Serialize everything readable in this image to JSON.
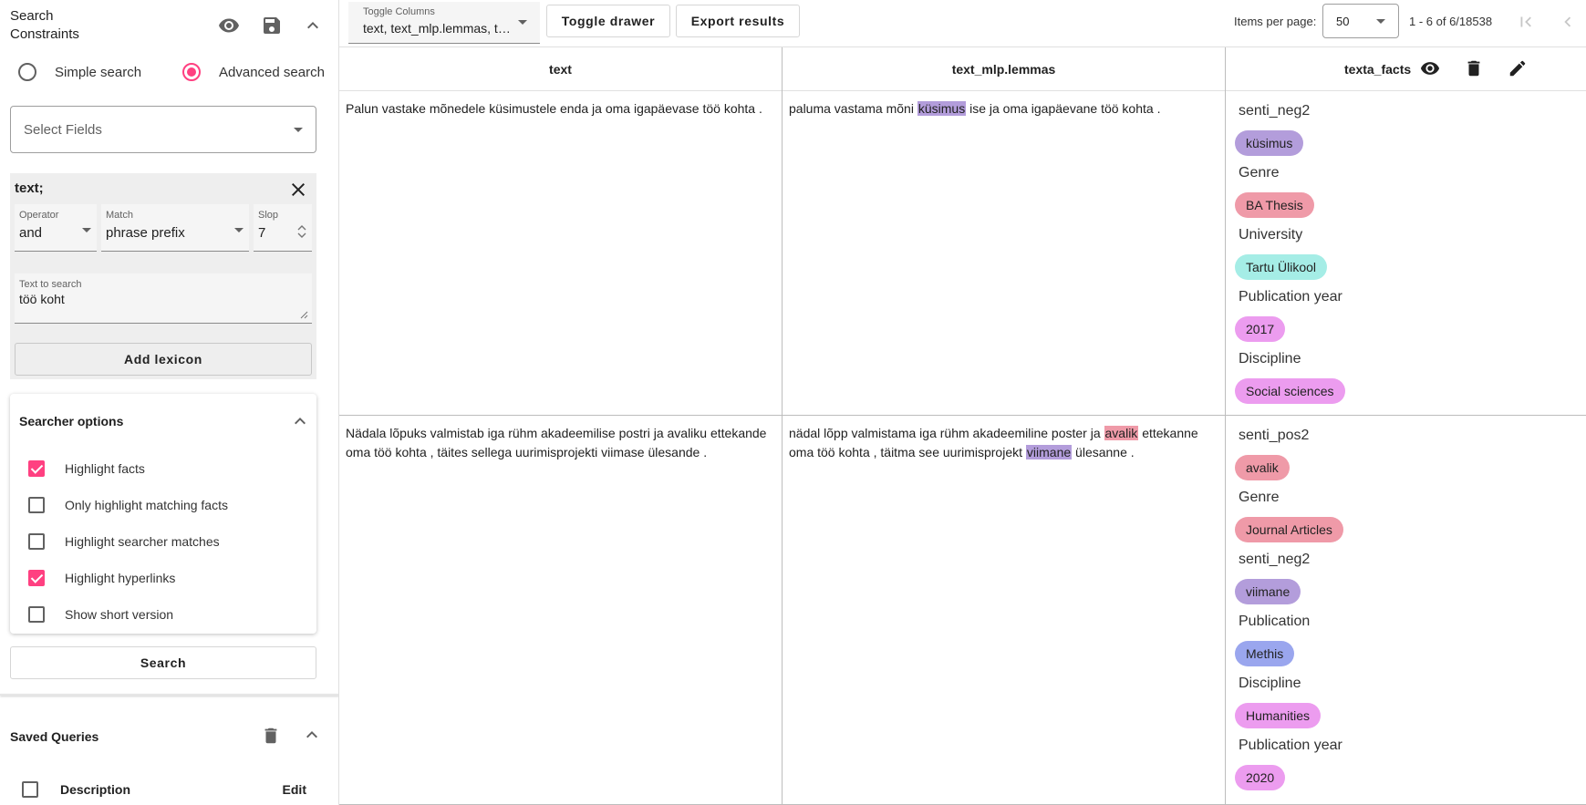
{
  "drawer": {
    "title": "Search Constraints",
    "search_mode": {
      "simple_label": "Simple search",
      "advanced_label": "Advanced search",
      "selected": "advanced"
    },
    "select_fields_placeholder": "Select Fields",
    "constraint": {
      "title": "text;",
      "operator_label": "Operator",
      "operator_value": "and",
      "match_label": "Match",
      "match_value": "phrase prefix",
      "slop_label": "Slop",
      "slop_value": "7",
      "text_label": "Text to search",
      "text_value": "töö koht",
      "add_lexicon_label": "Add lexicon"
    },
    "searcher_options": {
      "title": "Searcher options",
      "items": [
        {
          "label": "Highlight facts",
          "checked": true
        },
        {
          "label": "Only highlight matching facts",
          "checked": false
        },
        {
          "label": "Highlight searcher matches",
          "checked": false
        },
        {
          "label": "Highlight hyperlinks",
          "checked": true
        },
        {
          "label": "Show short version",
          "checked": false
        }
      ]
    },
    "search_button_label": "Search",
    "saved_queries": {
      "title": "Saved Queries",
      "col_description": "Description",
      "col_edit": "Edit"
    }
  },
  "toolbar": {
    "toggle_columns_label": "Toggle Columns",
    "toggle_columns_value": "text, text_mlp.lemmas, texta_facts",
    "toggle_drawer_label": "Toggle drawer",
    "export_results_label": "Export results",
    "items_per_page_label": "Items per page:",
    "items_per_page_value": "50",
    "range_label": "1 - 6 of 6/18538"
  },
  "colors": {
    "accent": "#ff4081",
    "chip_purple": "#b39ddb",
    "chip_pink": "#ef9aa8",
    "chip_cyan": "#a5ede6",
    "chip_magenta": "#ec9cef",
    "chip_blue": "#9aa6ee"
  },
  "table": {
    "columns": [
      "text",
      "text_mlp.lemmas",
      "texta_facts"
    ],
    "rows": [
      {
        "text": "Palun vastake mõnedele küsimustele enda ja oma igapäevase töö kohta .",
        "lemmas": [
          {
            "t": "paluma vastama mõni ",
            "hl": null
          },
          {
            "t": "küsimus",
            "hl": "#b39ddb"
          },
          {
            "t": " ise ja oma igapäevane töö kohta .",
            "hl": null
          }
        ],
        "facts": [
          {
            "name": "senti_neg2",
            "value": "küsimus",
            "color": "#b39ddb"
          },
          {
            "name": "Genre",
            "value": "BA Thesis",
            "color": "#ef9aa8"
          },
          {
            "name": "University",
            "value": "Tartu Ülikool",
            "color": "#a5ede6"
          },
          {
            "name": "Publication year",
            "value": "2017",
            "color": "#ec9cef"
          },
          {
            "name": "Discipline",
            "value": "Social sciences",
            "color": "#ec9cef"
          }
        ]
      },
      {
        "text": "Nädala lõpuks valmistab iga rühm akadeemilise postri ja avaliku ettekande oma töö kohta , täites sellega uurimisprojekti viimase ülesande .",
        "lemmas": [
          {
            "t": "nädal lõpp valmistama iga rühm akadeemiline poster ja ",
            "hl": null
          },
          {
            "t": "avalik",
            "hl": "#ef9aa8"
          },
          {
            "t": " ettekanne oma töö kohta , täitma see uurimisprojekt ",
            "hl": null
          },
          {
            "t": "viimane",
            "hl": "#b39ddb"
          },
          {
            "t": " ülesanne .",
            "hl": null
          }
        ],
        "facts": [
          {
            "name": "senti_pos2",
            "value": "avalik",
            "color": "#ef9aa8"
          },
          {
            "name": "Genre",
            "value": "Journal Articles",
            "color": "#ef9aa8"
          },
          {
            "name": "senti_neg2",
            "value": "viimane",
            "color": "#b39ddb"
          },
          {
            "name": "Publication",
            "value": "Methis",
            "color": "#9aa6ee"
          },
          {
            "name": "Discipline",
            "value": "Humanities",
            "color": "#ec9cef"
          },
          {
            "name": "Publication year",
            "value": "2020",
            "color": "#ec9cef"
          }
        ]
      }
    ]
  },
  "icons": {
    "visibility": "eye-icon",
    "save": "save-icon",
    "collapse": "chevron-up-icon",
    "close": "close-icon",
    "trash": "trash-icon",
    "edit": "pencil-icon",
    "first_page": "first-page-icon",
    "prev_page": "chevron-left-icon"
  }
}
